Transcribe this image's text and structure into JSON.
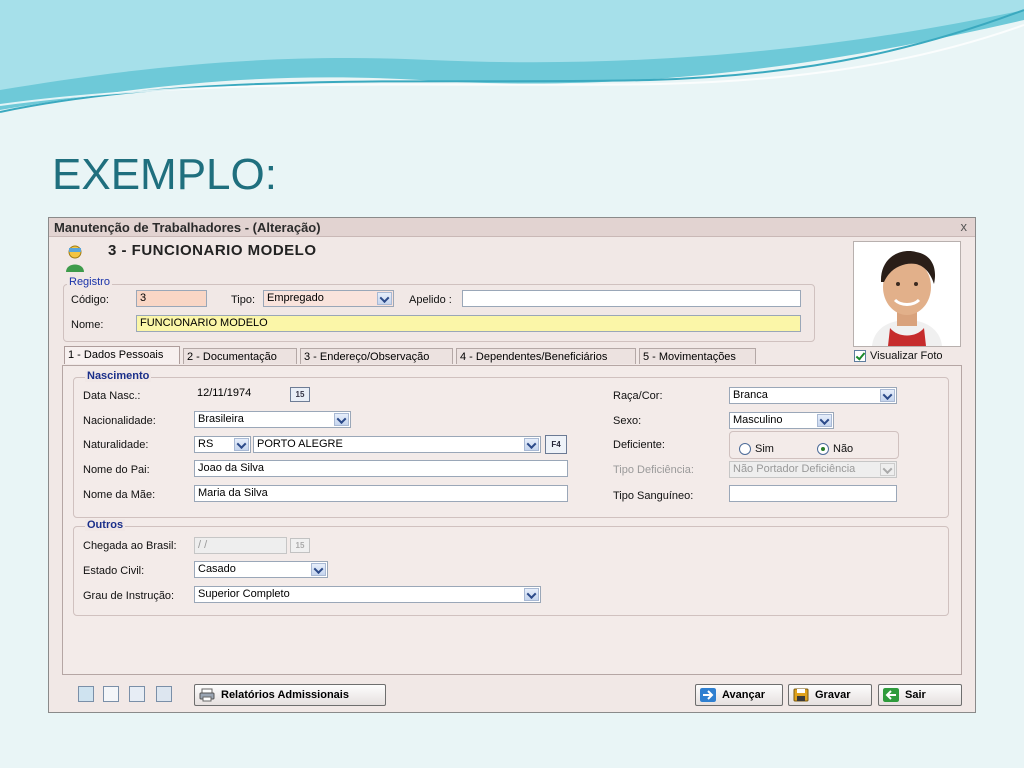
{
  "slide": {
    "title": "EXEMPLO:"
  },
  "window": {
    "title": "Manutenção de Trabalhadores - (Alteração)",
    "close": "x",
    "header_title": "3 - FUNCIONARIO MODELO"
  },
  "registro": {
    "label": "Registro",
    "codigo_label": "Código:",
    "codigo_value": "3",
    "tipo_label": "Tipo:",
    "tipo_value": "Empregado",
    "apelido_label": "Apelido :",
    "apelido_value": "",
    "nome_label": "Nome:",
    "nome_value": "FUNCIONARIO MODELO"
  },
  "visualizar_foto": {
    "label": "Visualizar Foto",
    "checked": true
  },
  "tabs": [
    {
      "label": "1 - Dados Pessoais",
      "active": true
    },
    {
      "label": "2 - Documentação",
      "active": false
    },
    {
      "label": "3 - Endereço/Observação",
      "active": false
    },
    {
      "label": "4 - Dependentes/Beneficiários",
      "active": false
    },
    {
      "label": "5 - Movimentações",
      "active": false
    }
  ],
  "nascimento": {
    "label": "Nascimento",
    "data_nasc_label": "Data Nasc.:",
    "data_nasc_value": "12/11/1974",
    "nacionalidade_label": "Nacionalidade:",
    "nacionalidade_value": "Brasileira",
    "naturalidade_label": "Naturalidade:",
    "naturalidade_uf": "RS",
    "naturalidade_cidade": "PORTO ALEGRE",
    "nome_pai_label": "Nome do Pai:",
    "nome_pai_value": "Joao da Silva",
    "nome_mae_label": "Nome da Mãe:",
    "nome_mae_value": "Maria da Silva",
    "raca_label": "Raça/Cor:",
    "raca_value": "Branca",
    "sexo_label": "Sexo:",
    "sexo_value": "Masculino",
    "deficiente_label": "Deficiente:",
    "deficiente_sim": "Sim",
    "deficiente_nao": "Não",
    "deficiente_selected": "Não",
    "tipo_deficiencia_label": "Tipo Deficiência:",
    "tipo_deficiencia_value": "Não Portador Deficiência",
    "tipo_sanguineo_label": "Tipo Sanguíneo:",
    "tipo_sanguineo_value": ""
  },
  "outros": {
    "label": "Outros",
    "chegada_label": "Chegada ao Brasil:",
    "chegada_value": "/ /",
    "estado_civil_label": "Estado Civil:",
    "estado_civil_value": "Casado",
    "grau_label": "Grau de Instrução:",
    "grau_value": "Superior Completo"
  },
  "buttons": {
    "relatorios": "Relatórios Admissionais",
    "avancar": "Avançar",
    "gravar": "Gravar",
    "sair": "Sair"
  },
  "calendar_glyph": "15",
  "f4_glyph": "F4",
  "colors": {
    "slide_title": "#1f6f7e",
    "group_label": "#1a2f8a",
    "nome_bg": "#fbf6a8",
    "codigo_bg": "#f9d6c5"
  }
}
